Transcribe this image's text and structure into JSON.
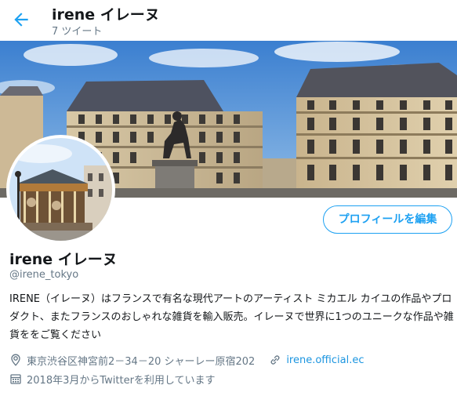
{
  "header": {
    "title": "irene イレーヌ",
    "tweet_count": "7 ツイート",
    "back_icon": "arrow-left-icon"
  },
  "colors": {
    "accent": "#1da1f2",
    "link": "#1b95e0",
    "secondary_text": "#657786",
    "primary_text": "#14171a"
  },
  "profile": {
    "edit_button": "プロフィールを編集",
    "name": "irene イレーヌ",
    "handle": "@irene_tokyo",
    "bio": "IRENE（イレーヌ）はフランスで有名な現代アートのアーティスト ミカエル カイユの作品やプロダクト、またフランスのおしゃれな雑貨を輸入販売。イレーヌで世界に1つのユニークな作品や雑貨ををご覧ください",
    "location": "東京渋谷区神宮前2－34－20 シャーレー原宿202",
    "website": "irene.official.ec",
    "joined": "2018年3月からTwitterを利用しています",
    "location_icon": "map-pin-icon",
    "link_icon": "link-icon",
    "calendar_icon": "calendar-icon"
  }
}
